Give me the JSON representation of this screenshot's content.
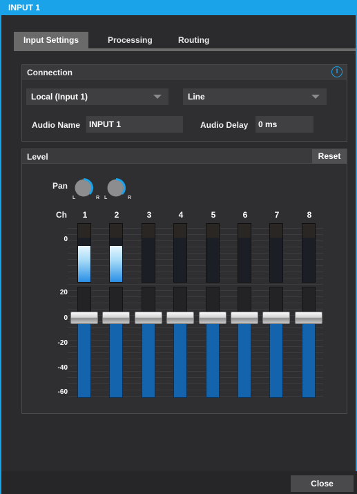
{
  "window": {
    "title": "INPUT 1",
    "accent": "#1aa3e8"
  },
  "tabs": [
    {
      "label": "Input Settings",
      "active": true
    },
    {
      "label": "Processing",
      "active": false
    },
    {
      "label": "Routing",
      "active": false
    }
  ],
  "connection": {
    "title": "Connection",
    "source_value": "Local (Input 1)",
    "type_value": "Line",
    "audio_name_label": "Audio Name",
    "audio_name_value": "INPUT 1",
    "audio_delay_label": "Audio Delay",
    "audio_delay_value": "0 ms",
    "info_icon": "info-icon"
  },
  "level": {
    "title": "Level",
    "reset_label": "Reset",
    "pan_label": "Pan",
    "pan_l": "L",
    "pan_r": "R",
    "ch_label": "Ch",
    "channels": [
      "1",
      "2",
      "3",
      "4",
      "5",
      "6",
      "7",
      "8"
    ],
    "meter_scale": [
      "0"
    ],
    "fader_scale": [
      "20",
      "0",
      "-20",
      "-40",
      "-60"
    ],
    "meter_levels": [
      0.6,
      0.6,
      0,
      0,
      0,
      0,
      0,
      0
    ],
    "fader_db": [
      0,
      0,
      0,
      0,
      0,
      0,
      0,
      0
    ]
  },
  "footer": {
    "close_label": "Close"
  }
}
